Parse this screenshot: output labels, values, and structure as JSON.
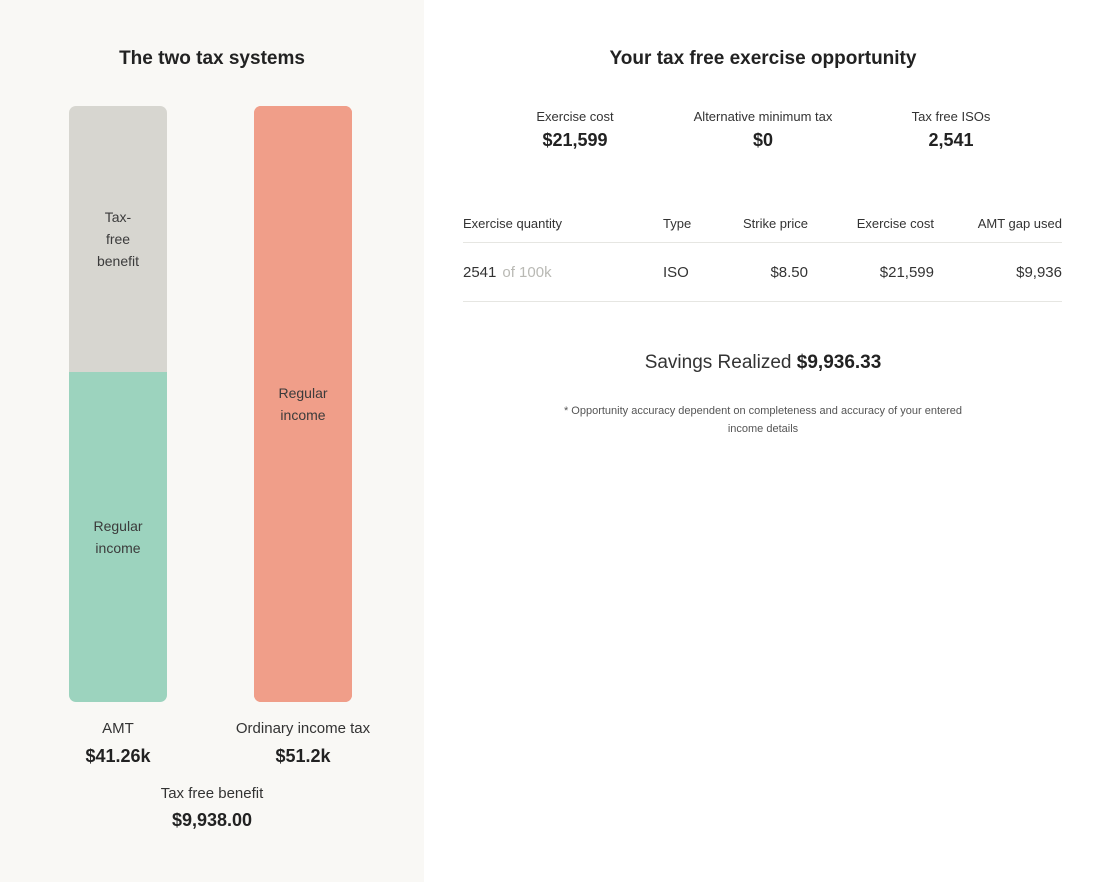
{
  "left_panel": {
    "title": "The two tax systems",
    "amt_bar": {
      "tax_free_segment": [
        "Tax-",
        "free",
        "benefit"
      ],
      "regular_segment": [
        "Regular",
        "income"
      ],
      "caption": "AMT",
      "value": "$41.26k",
      "tax_free_fraction": 0.447
    },
    "ordinary_bar": {
      "regular_segment": [
        "Regular",
        "income"
      ],
      "caption": "Ordinary income tax",
      "value": "$51.2k"
    },
    "benefit": {
      "label": "Tax free benefit",
      "value": "$9,938.00"
    },
    "colors": {
      "panel_bg": "#f9f8f5",
      "tax_free": "#d7d6d0",
      "regular_amt": "#9cd3be",
      "regular_ordinary": "#f09e89"
    }
  },
  "right_panel": {
    "title": "Your tax free exercise opportunity",
    "stats": [
      {
        "label": "Exercise cost",
        "value": "$21,599"
      },
      {
        "label": "Alternative minimum tax",
        "value": "$0"
      },
      {
        "label": "Tax free ISOs",
        "value": "2,541"
      }
    ],
    "table": {
      "headers": [
        "Exercise quantity",
        "Type",
        "Strike price",
        "Exercise cost",
        "AMT gap used"
      ],
      "rows": [
        {
          "quantity": "2541",
          "quantity_of": "of 100k",
          "type": "ISO",
          "strike_price": "$8.50",
          "exercise_cost": "$21,599",
          "amt_gap_used": "$9,936"
        }
      ]
    },
    "savings": {
      "label": "Savings Realized",
      "value": "$9,936.33"
    },
    "footnote": "* Opportunity accuracy dependent on completeness and accuracy of your entered income details"
  }
}
